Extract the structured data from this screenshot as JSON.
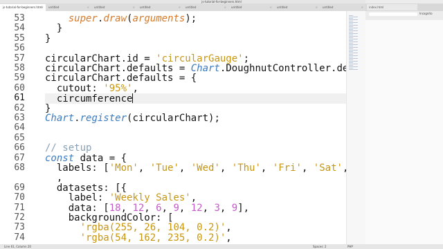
{
  "window": {
    "title": "js-tutorial-for-beginners.html",
    "unregistered": "UNREGISTERED"
  },
  "tabs": [
    {
      "label": "js-tutorial-for-beginners.html",
      "active": true
    },
    {
      "label": "untitled",
      "active": false
    },
    {
      "label": "untitled",
      "active": false
    },
    {
      "label": "untitled",
      "active": false
    },
    {
      "label": "untitled",
      "active": false
    },
    {
      "label": "untitled",
      "active": false
    },
    {
      "label": "untitled",
      "active": false
    },
    {
      "label": "untitled",
      "active": false
    }
  ],
  "browser": {
    "tab_label": "index.html",
    "incognito_label": "Incognito"
  },
  "editor": {
    "lines": [
      {
        "n": "53",
        "tokens": [
          [
            "    ",
            ""
          ],
          [
            "super",
            "kw-orange"
          ],
          [
            ".",
            ""
          ],
          [
            "draw",
            "kw-orange"
          ],
          [
            "(",
            ""
          ],
          [
            "arguments",
            "kw-orange"
          ],
          [
            ");",
            ""
          ]
        ]
      },
      {
        "n": "54",
        "tokens": [
          [
            "  }",
            ""
          ]
        ]
      },
      {
        "n": "55",
        "tokens": [
          [
            "}",
            ""
          ]
        ]
      },
      {
        "n": "56",
        "tokens": []
      },
      {
        "n": "57",
        "tokens": [
          [
            "circularChart.id = ",
            ""
          ],
          [
            "'circularGauge'",
            "str"
          ],
          [
            ";",
            ""
          ]
        ]
      },
      {
        "n": "58",
        "tokens": [
          [
            "circularChart.defaults = ",
            ""
          ],
          [
            "Chart",
            "kw-blue"
          ],
          [
            ".DoughnutController.defaults;",
            ""
          ]
        ]
      },
      {
        "n": "59",
        "tokens": [
          [
            "circularChart.defaults = {",
            ""
          ]
        ]
      },
      {
        "n": "60",
        "tokens": [
          [
            "  cutout: ",
            ""
          ],
          [
            "'95%'",
            "str"
          ],
          [
            ",",
            ""
          ]
        ]
      },
      {
        "n": "61",
        "tokens": [
          [
            "  circumference",
            ""
          ]
        ],
        "cursor": true
      },
      {
        "n": "62",
        "tokens": [
          [
            "}",
            ""
          ]
        ]
      },
      {
        "n": "63",
        "tokens": [
          [
            "Chart",
            "kw-blue"
          ],
          [
            ".",
            ""
          ],
          [
            "register",
            "kw-blue"
          ],
          [
            "(circularChart);",
            ""
          ]
        ]
      },
      {
        "n": "64",
        "tokens": []
      },
      {
        "n": "65",
        "tokens": []
      },
      {
        "n": "66",
        "tokens": [
          [
            "// setup",
            "cmt"
          ]
        ]
      },
      {
        "n": "67",
        "tokens": [
          [
            "const",
            "kw-blue"
          ],
          [
            " data = {",
            ""
          ]
        ]
      },
      {
        "n": "68",
        "tokens": [
          [
            "  labels: [",
            ""
          ],
          [
            "'Mon'",
            "str"
          ],
          [
            ", ",
            ""
          ],
          [
            "'Tue'",
            "str"
          ],
          [
            ", ",
            ""
          ],
          [
            "'Wed'",
            "str"
          ],
          [
            ", ",
            ""
          ],
          [
            "'Thu'",
            "str"
          ],
          [
            ", ",
            ""
          ],
          [
            "'Fri'",
            "str"
          ],
          [
            ", ",
            ""
          ],
          [
            "'Sat'",
            "str"
          ],
          [
            ", ",
            ""
          ],
          [
            "'Sun'",
            "str"
          ],
          [
            "]",
            ""
          ]
        ]
      },
      {
        "n": "",
        "tokens": [
          [
            "  ,",
            ""
          ]
        ]
      },
      {
        "n": "69",
        "tokens": [
          [
            "  datasets: [{",
            ""
          ]
        ]
      },
      {
        "n": "70",
        "tokens": [
          [
            "    label: ",
            ""
          ],
          [
            "'Weekly Sales'",
            "str"
          ],
          [
            ",",
            ""
          ]
        ]
      },
      {
        "n": "71",
        "tokens": [
          [
            "    data: [",
            ""
          ],
          [
            "18",
            "num"
          ],
          [
            ", ",
            ""
          ],
          [
            "12",
            "num"
          ],
          [
            ", ",
            ""
          ],
          [
            "6",
            "num"
          ],
          [
            ", ",
            ""
          ],
          [
            "9",
            "num"
          ],
          [
            ", ",
            ""
          ],
          [
            "12",
            "num"
          ],
          [
            ", ",
            ""
          ],
          [
            "3",
            "num"
          ],
          [
            ", ",
            ""
          ],
          [
            "9",
            "num"
          ],
          [
            "],",
            ""
          ]
        ]
      },
      {
        "n": "72",
        "tokens": [
          [
            "    backgroundColor: [",
            ""
          ]
        ]
      },
      {
        "n": "73",
        "tokens": [
          [
            "      ",
            ""
          ],
          [
            "'rgba(255, 26, 104, 0.2)'",
            "str"
          ],
          [
            ",",
            ""
          ]
        ]
      },
      {
        "n": "74",
        "tokens": [
          [
            "      ",
            ""
          ],
          [
            "'rgba(54, 162, 235, 0.2)'",
            "str"
          ],
          [
            ",",
            ""
          ]
        ]
      }
    ]
  },
  "status": {
    "position": "Line 61, Column 20",
    "spaces": "Spaces: 2",
    "syntax": "PHP"
  }
}
